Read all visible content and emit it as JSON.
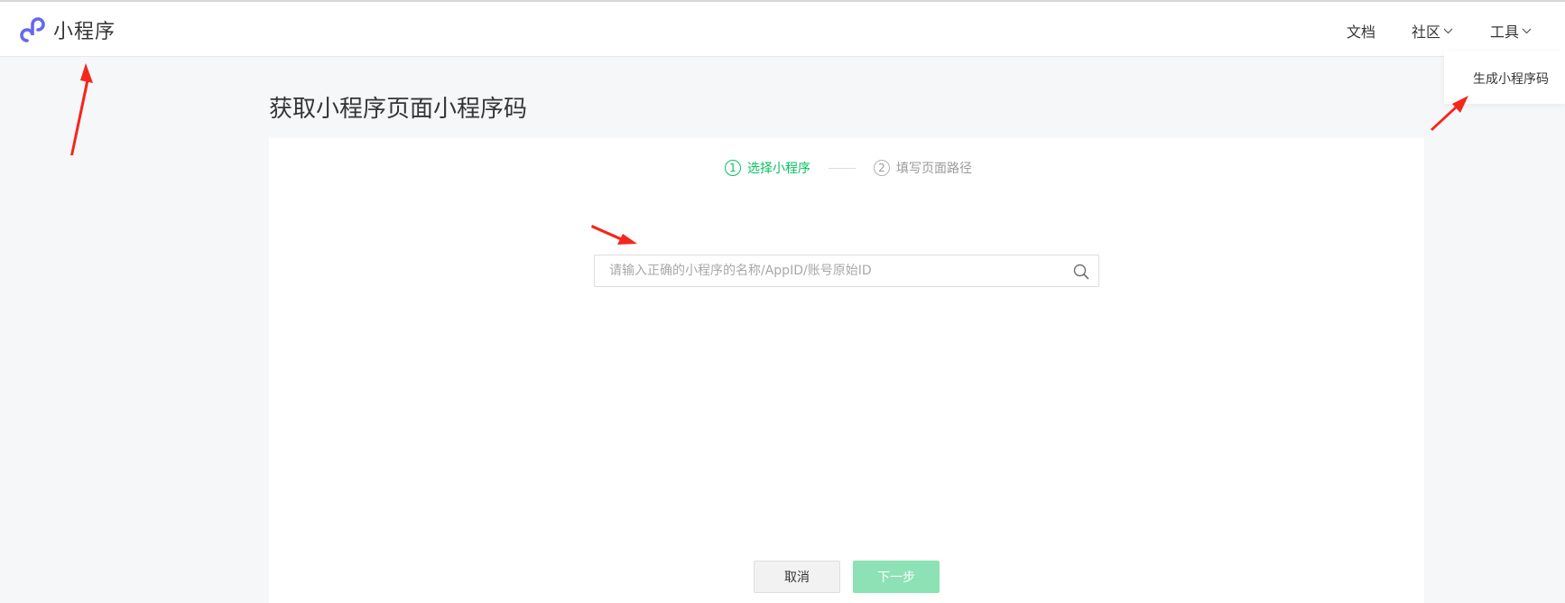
{
  "header": {
    "logo_text": "小程序",
    "nav": {
      "docs": "文档",
      "community": "社区",
      "tools": "工具"
    },
    "dropdown": {
      "item": "生成小程序码"
    }
  },
  "page": {
    "title": "获取小程序页面小程序码"
  },
  "steps": [
    {
      "number": "1",
      "label": "选择小程序",
      "state": "active"
    },
    {
      "number": "2",
      "label": "填写页面路径",
      "state": "inactive"
    }
  ],
  "search": {
    "placeholder": "请输入正确的小程序的名称/AppID/账号原始ID",
    "value": ""
  },
  "buttons": {
    "cancel": "取消",
    "next": "下一步"
  },
  "colors": {
    "accent": "#07c160",
    "logo": "#6467f0",
    "next_disabled": "#8ce2b4",
    "annotation_arrow": "#f5261c"
  }
}
